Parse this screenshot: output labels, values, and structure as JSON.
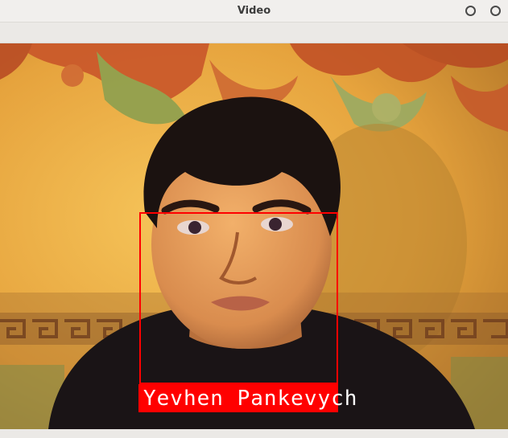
{
  "window": {
    "title": "Video"
  },
  "overlay": {
    "name_label": "Yevhen Pankevych",
    "box_color": "#ff0000",
    "label_text_color": "#ffffff"
  },
  "icons": {
    "minimize": "circle-outline",
    "close": "circle-outline"
  }
}
